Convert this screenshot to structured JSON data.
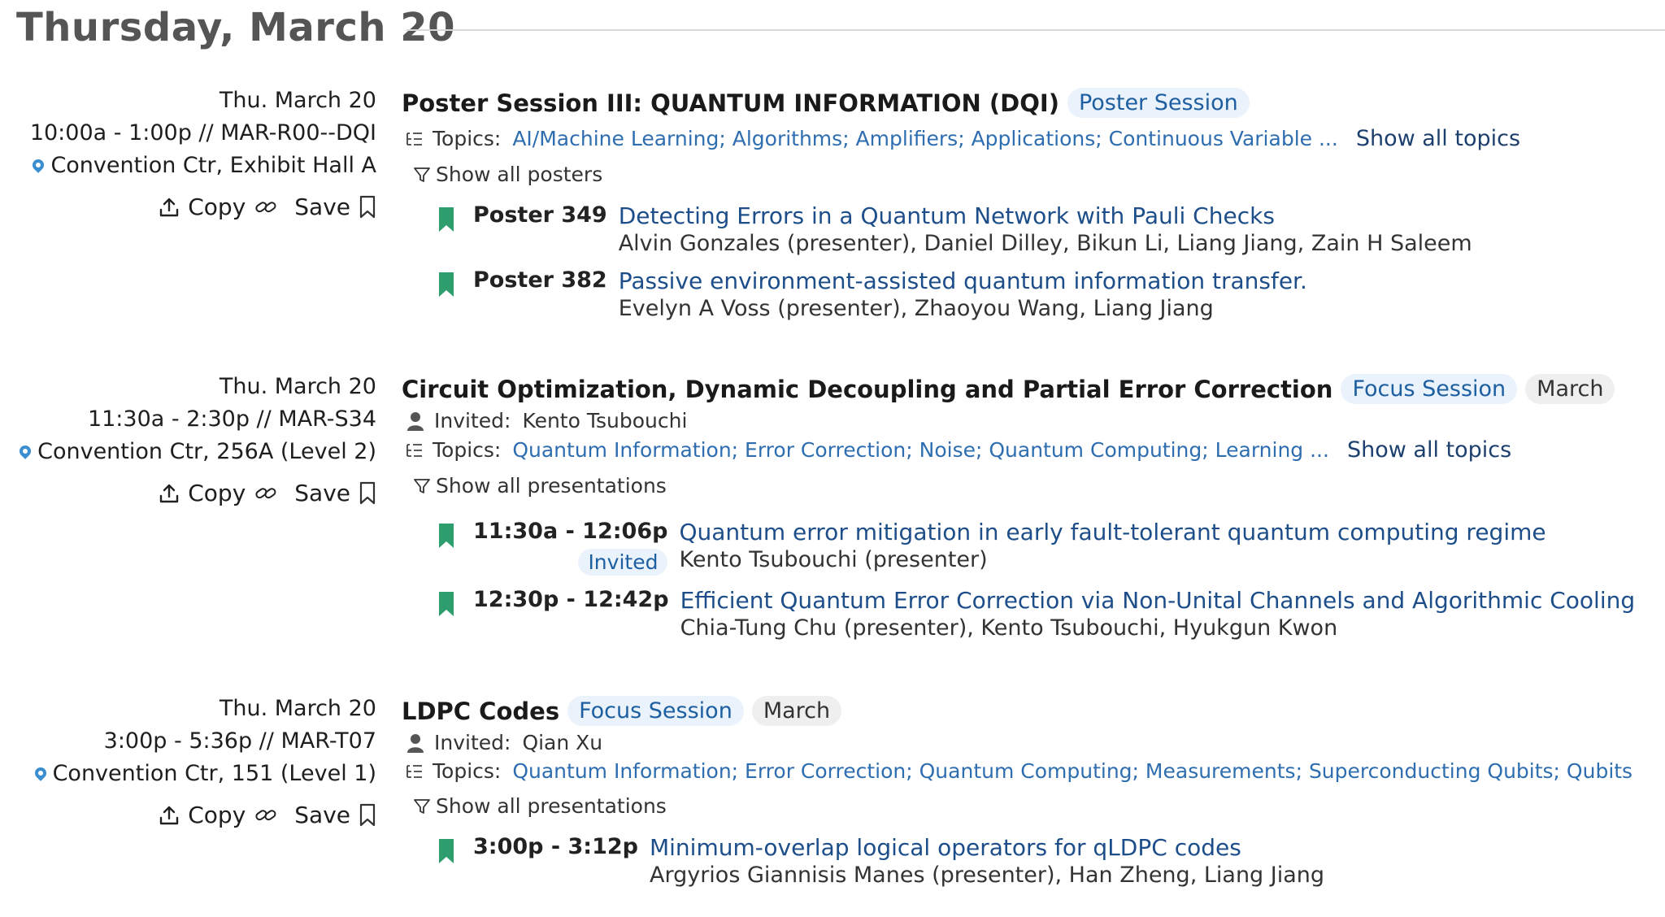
{
  "day": {
    "title": "Thursday, March 20"
  },
  "sessions": [
    {
      "date": "Thu. March 20",
      "time_code": "10:00a - 1:00p // MAR-R00--DQI",
      "location": "Convention Ctr, Exhibit Hall A",
      "actions": {
        "copy": "Copy",
        "save": "Save"
      },
      "title": "Poster Session III: QUANTUM INFORMATION (DQI)",
      "badges": [
        "Poster Session"
      ],
      "topics_label": "Topics:",
      "topics": "AI/Machine Learning; Algorithms; Amplifiers; Applications; Continuous Variable ...",
      "show_topics": "Show all topics",
      "filter": "Show all posters",
      "items": [
        {
          "time": "Poster 349",
          "title": "Detecting Errors in a Quantum Network with Pauli Checks",
          "authors": "Alvin Gonzales (presenter), Daniel Dilley, Bikun Li, Liang Jiang, Zain H Saleem"
        },
        {
          "time": "Poster 382",
          "title": "Passive environment-assisted quantum information transfer.",
          "authors": "Evelyn A Voss (presenter), Zhaoyou Wang, Liang Jiang"
        }
      ]
    },
    {
      "date": "Thu. March 20",
      "time_code": "11:30a - 2:30p // MAR-S34",
      "location": "Convention Ctr, 256A (Level 2)",
      "actions": {
        "copy": "Copy",
        "save": "Save"
      },
      "title": "Circuit Optimization, Dynamic Decoupling and Partial Error Correction",
      "badges": [
        "Focus Session",
        "March"
      ],
      "invited_label": "Invited:",
      "invited": "Kento Tsubouchi",
      "topics_label": "Topics:",
      "topics": "Quantum Information; Error Correction; Noise; Quantum Computing; Learning ...",
      "show_topics": "Show all topics",
      "filter": "Show all presentations",
      "items": [
        {
          "time": "11:30a - 12:06p",
          "badge": "Invited",
          "title": "Quantum error mitigation in early fault-tolerant quantum computing regime",
          "authors": "Kento Tsubouchi (presenter)"
        },
        {
          "time": "12:30p - 12:42p",
          "title": "Efficient Quantum Error Correction via Non-Unital Channels and Algorithmic Cooling",
          "authors": "Chia-Tung Chu (presenter), Kento Tsubouchi, Hyukgun Kwon"
        }
      ]
    },
    {
      "date": "Thu. March 20",
      "time_code": "3:00p - 5:36p // MAR-T07",
      "location": "Convention Ctr, 151 (Level 1)",
      "actions": {
        "copy": "Copy",
        "save": "Save"
      },
      "title": "LDPC Codes",
      "badges": [
        "Focus Session",
        "March"
      ],
      "invited_label": "Invited:",
      "invited": "Qian Xu",
      "topics_label": "Topics:",
      "topics": "Quantum Information; Error Correction; Quantum Computing; Measurements; Superconducting Qubits; Qubits",
      "filter": "Show all presentations",
      "items": [
        {
          "time": "3:00p - 3:12p",
          "title": "Minimum-overlap logical operators for qLDPC codes",
          "authors": "Argyrios Giannisis Manes (presenter), Han Zheng, Liang Jiang"
        }
      ]
    }
  ]
}
